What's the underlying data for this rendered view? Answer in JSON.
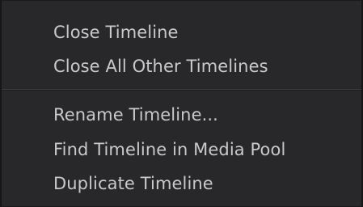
{
  "context_menu": {
    "group1": [
      {
        "label": "Close Timeline"
      },
      {
        "label": "Close All Other Timelines"
      }
    ],
    "group2": [
      {
        "label": "Rename Timeline..."
      },
      {
        "label": "Find Timeline in Media Pool"
      },
      {
        "label": "Duplicate Timeline"
      }
    ]
  },
  "colors": {
    "menu_background": "#28282a",
    "text": "#c9c9ca",
    "separator": "#3e3e40"
  }
}
